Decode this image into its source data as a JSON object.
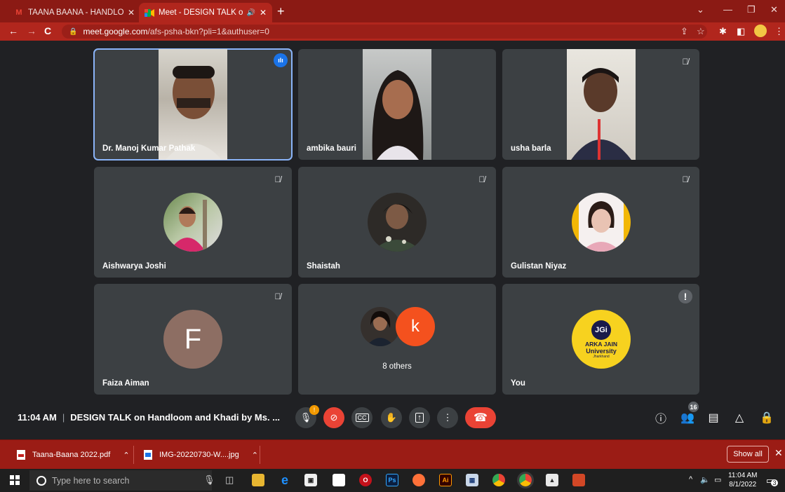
{
  "browser": {
    "tabs": [
      {
        "title": "TAANA BAANA - HANDLOOM AN",
        "favicon": "gmail-icon",
        "active": false
      },
      {
        "title": "Meet - DESIGN TALK on Han",
        "favicon": "meet-icon",
        "active": true
      }
    ],
    "url_host": "meet.google.com",
    "url_path": "/afs-psha-bkn?pli=1&authuser=0"
  },
  "participants": [
    {
      "name": "Dr. Manoj Kumar Pathak",
      "state": "speaking"
    },
    {
      "name": "ambika bauri",
      "state": "unmuted"
    },
    {
      "name": "usha barla",
      "state": "muted"
    },
    {
      "name": "Aishwarya Joshi",
      "state": "muted"
    },
    {
      "name": "Shaistah",
      "state": "muted"
    },
    {
      "name": "Gulistan Niyaz",
      "state": "muted"
    },
    {
      "name": "Faiza Aiman",
      "state": "muted",
      "initial": "F"
    },
    {
      "name": "8 others",
      "state": "group",
      "initial": "k"
    },
    {
      "name": "You",
      "state": "alert",
      "logo_lines": [
        "JGi",
        "ARKA JAIN",
        "University",
        "Jharkhand"
      ]
    }
  ],
  "meeting": {
    "time": "11:04 AM",
    "separator": "|",
    "title": "DESIGN TALK on Handloom and Khadi by Ms. ...",
    "mic_alert": "!",
    "participant_count": "16"
  },
  "downloads": {
    "items": [
      {
        "name": "Taana-Baana 2022.pdf",
        "type": "pdf"
      },
      {
        "name": "IMG-20220730-W....jpg",
        "type": "img"
      }
    ],
    "show_all": "Show all"
  },
  "taskbar": {
    "search_placeholder": "Type here to search",
    "clock_time": "11:04 AM",
    "clock_date": "8/1/2022",
    "notification_count": "3"
  },
  "colors": {
    "chrome_frame": "#8b1a14",
    "meet_bg": "#202124",
    "tile_bg": "#3c4043",
    "end_call": "#ea4335",
    "speaking_outline": "#8ab4f8"
  }
}
